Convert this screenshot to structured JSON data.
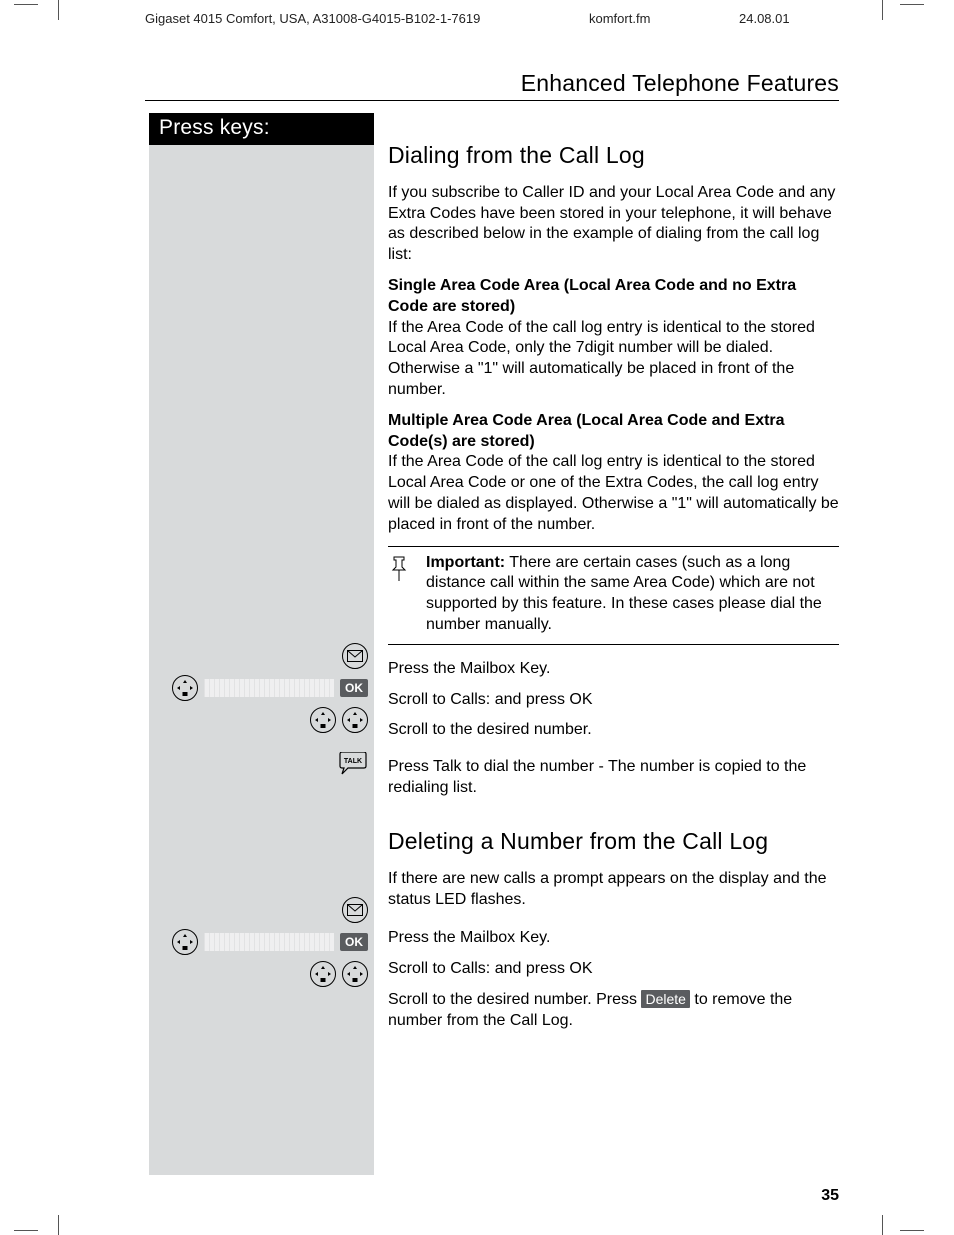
{
  "meta": {
    "product": "Gigaset 4015 Comfort, USA, A31008-G4015-B102-1-7619",
    "filename": "komfort.fm",
    "date": "24.08.01"
  },
  "section_title": "Enhanced Telephone Features",
  "sidebar": {
    "header": "Press keys:",
    "ok_label_1": "OK",
    "ok_label_2": "OK"
  },
  "headings": {
    "dialing": "Dialing from the Call Log",
    "deleting": "Deleting a Number from the Call Log"
  },
  "body": {
    "intro": "If you subscribe to Caller ID and your Local Area Code and any Extra Codes have been stored in your telephone, it will behave as described below in the example of dialing from the call log list:",
    "single_head": "Single Area Code Area (Local Area Code and no Extra Code are stored)",
    "single_body": "If the Area Code of the call log entry is identical to the stored Local Area Code, only the 7digit number will be dialed.  Otherwise a \"1\" will automatically be placed in front of the number.",
    "multi_head": "Multiple Area Code Area (Local Area Code and Extra Code(s) are stored)",
    "multi_body": "If the Area Code of the call log entry is identical to the stored Local Area Code or one of the Extra Codes, the call log entry will be dialed  as displayed.  Otherwise a \"1\" will automatically be placed in front of the number.",
    "note_label": "Important:",
    "note_body": " There are certain cases (such as a long distance call within the same Area Code) which are not supported by this feature. In these cases please dial the number manually.",
    "step_mailbox": "Press the Mailbox Key.",
    "step_scroll_calls": "Scroll to Calls: and press OK",
    "step_scroll_number": "Scroll to the desired number.",
    "step_talk": "Press Talk to dial the number - The number is copied to the redialing list.",
    "del_intro": "If there are new calls a prompt appears on the display and the status LED flashes.",
    "del_step_mailbox": "Press the Mailbox Key.",
    "del_step_scroll_calls": "Scroll to Calls: and press OK",
    "del_step_scroll_number_pre": "Scroll to the desired number. Press ",
    "del_key_label": "Delete",
    "del_step_scroll_number_post": " to remove the number from the Call Log."
  },
  "page_number": "35"
}
